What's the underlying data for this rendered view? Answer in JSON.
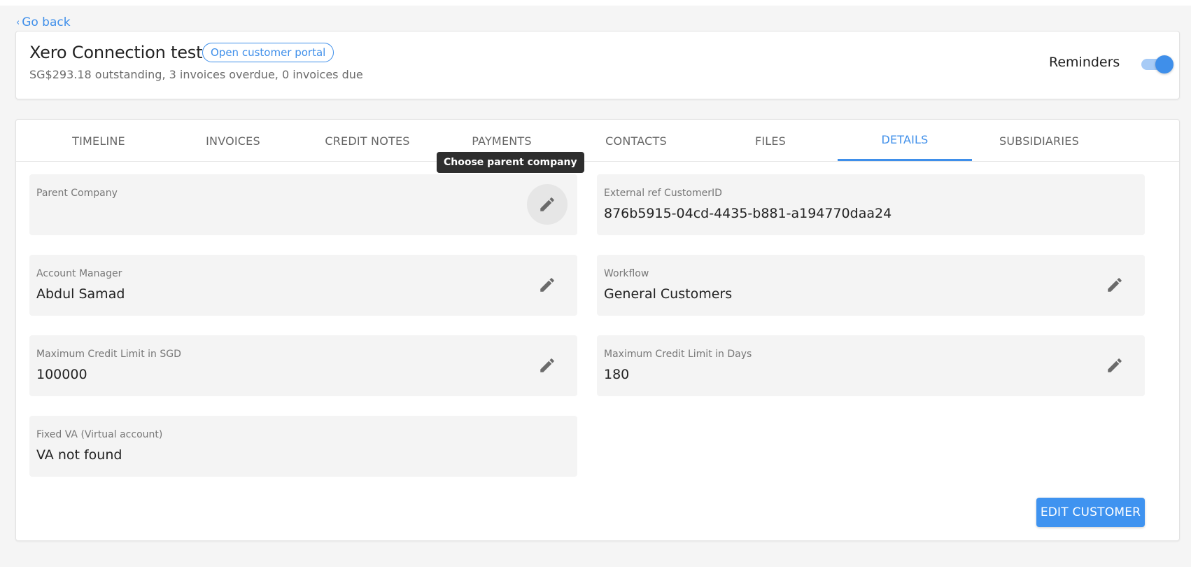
{
  "nav": {
    "back_label": "Go back"
  },
  "customer": {
    "name": "Xero Connection test",
    "portal_label": "Open customer portal",
    "summary": "SG$293.18 outstanding, 3 invoices overdue, 0 invoices due",
    "reminders_label": "Reminders",
    "reminders_enabled": true
  },
  "tabs": [
    {
      "label": "TIMELINE",
      "active": false
    },
    {
      "label": "INVOICES",
      "active": false
    },
    {
      "label": "CREDIT NOTES",
      "active": false
    },
    {
      "label": "PAYMENTS",
      "active": false
    },
    {
      "label": "CONTACTS",
      "active": false
    },
    {
      "label": "FILES",
      "active": false
    },
    {
      "label": "DETAILS",
      "active": true
    },
    {
      "label": "SUBSIDIARIES",
      "active": false
    }
  ],
  "tooltip": "Choose parent company",
  "fields": {
    "parent_company": {
      "label": "Parent Company",
      "value": ""
    },
    "external_ref": {
      "label": "External ref CustomerID",
      "value": "876b5915-04cd-4435-b881-a194770daa24"
    },
    "account_manager": {
      "label": "Account Manager",
      "value": "Abdul Samad"
    },
    "workflow": {
      "label": "Workflow",
      "value": "General Customers"
    },
    "credit_limit_sgd": {
      "label": "Maximum Credit Limit in SGD",
      "value": "100000"
    },
    "credit_limit_days": {
      "label": "Maximum Credit Limit in Days",
      "value": "180"
    },
    "fixed_va": {
      "label": "Fixed VA (Virtual account)",
      "value": "VA not found"
    }
  },
  "actions": {
    "edit_customer_label": "EDIT CUSTOMER"
  },
  "colors": {
    "accent": "#3f8fea",
    "field_bg": "#f4f4f4",
    "tooltip_bg": "#2e2e2e"
  },
  "icons": {
    "edit": "pencil-icon",
    "back": "chevron-left-icon"
  }
}
